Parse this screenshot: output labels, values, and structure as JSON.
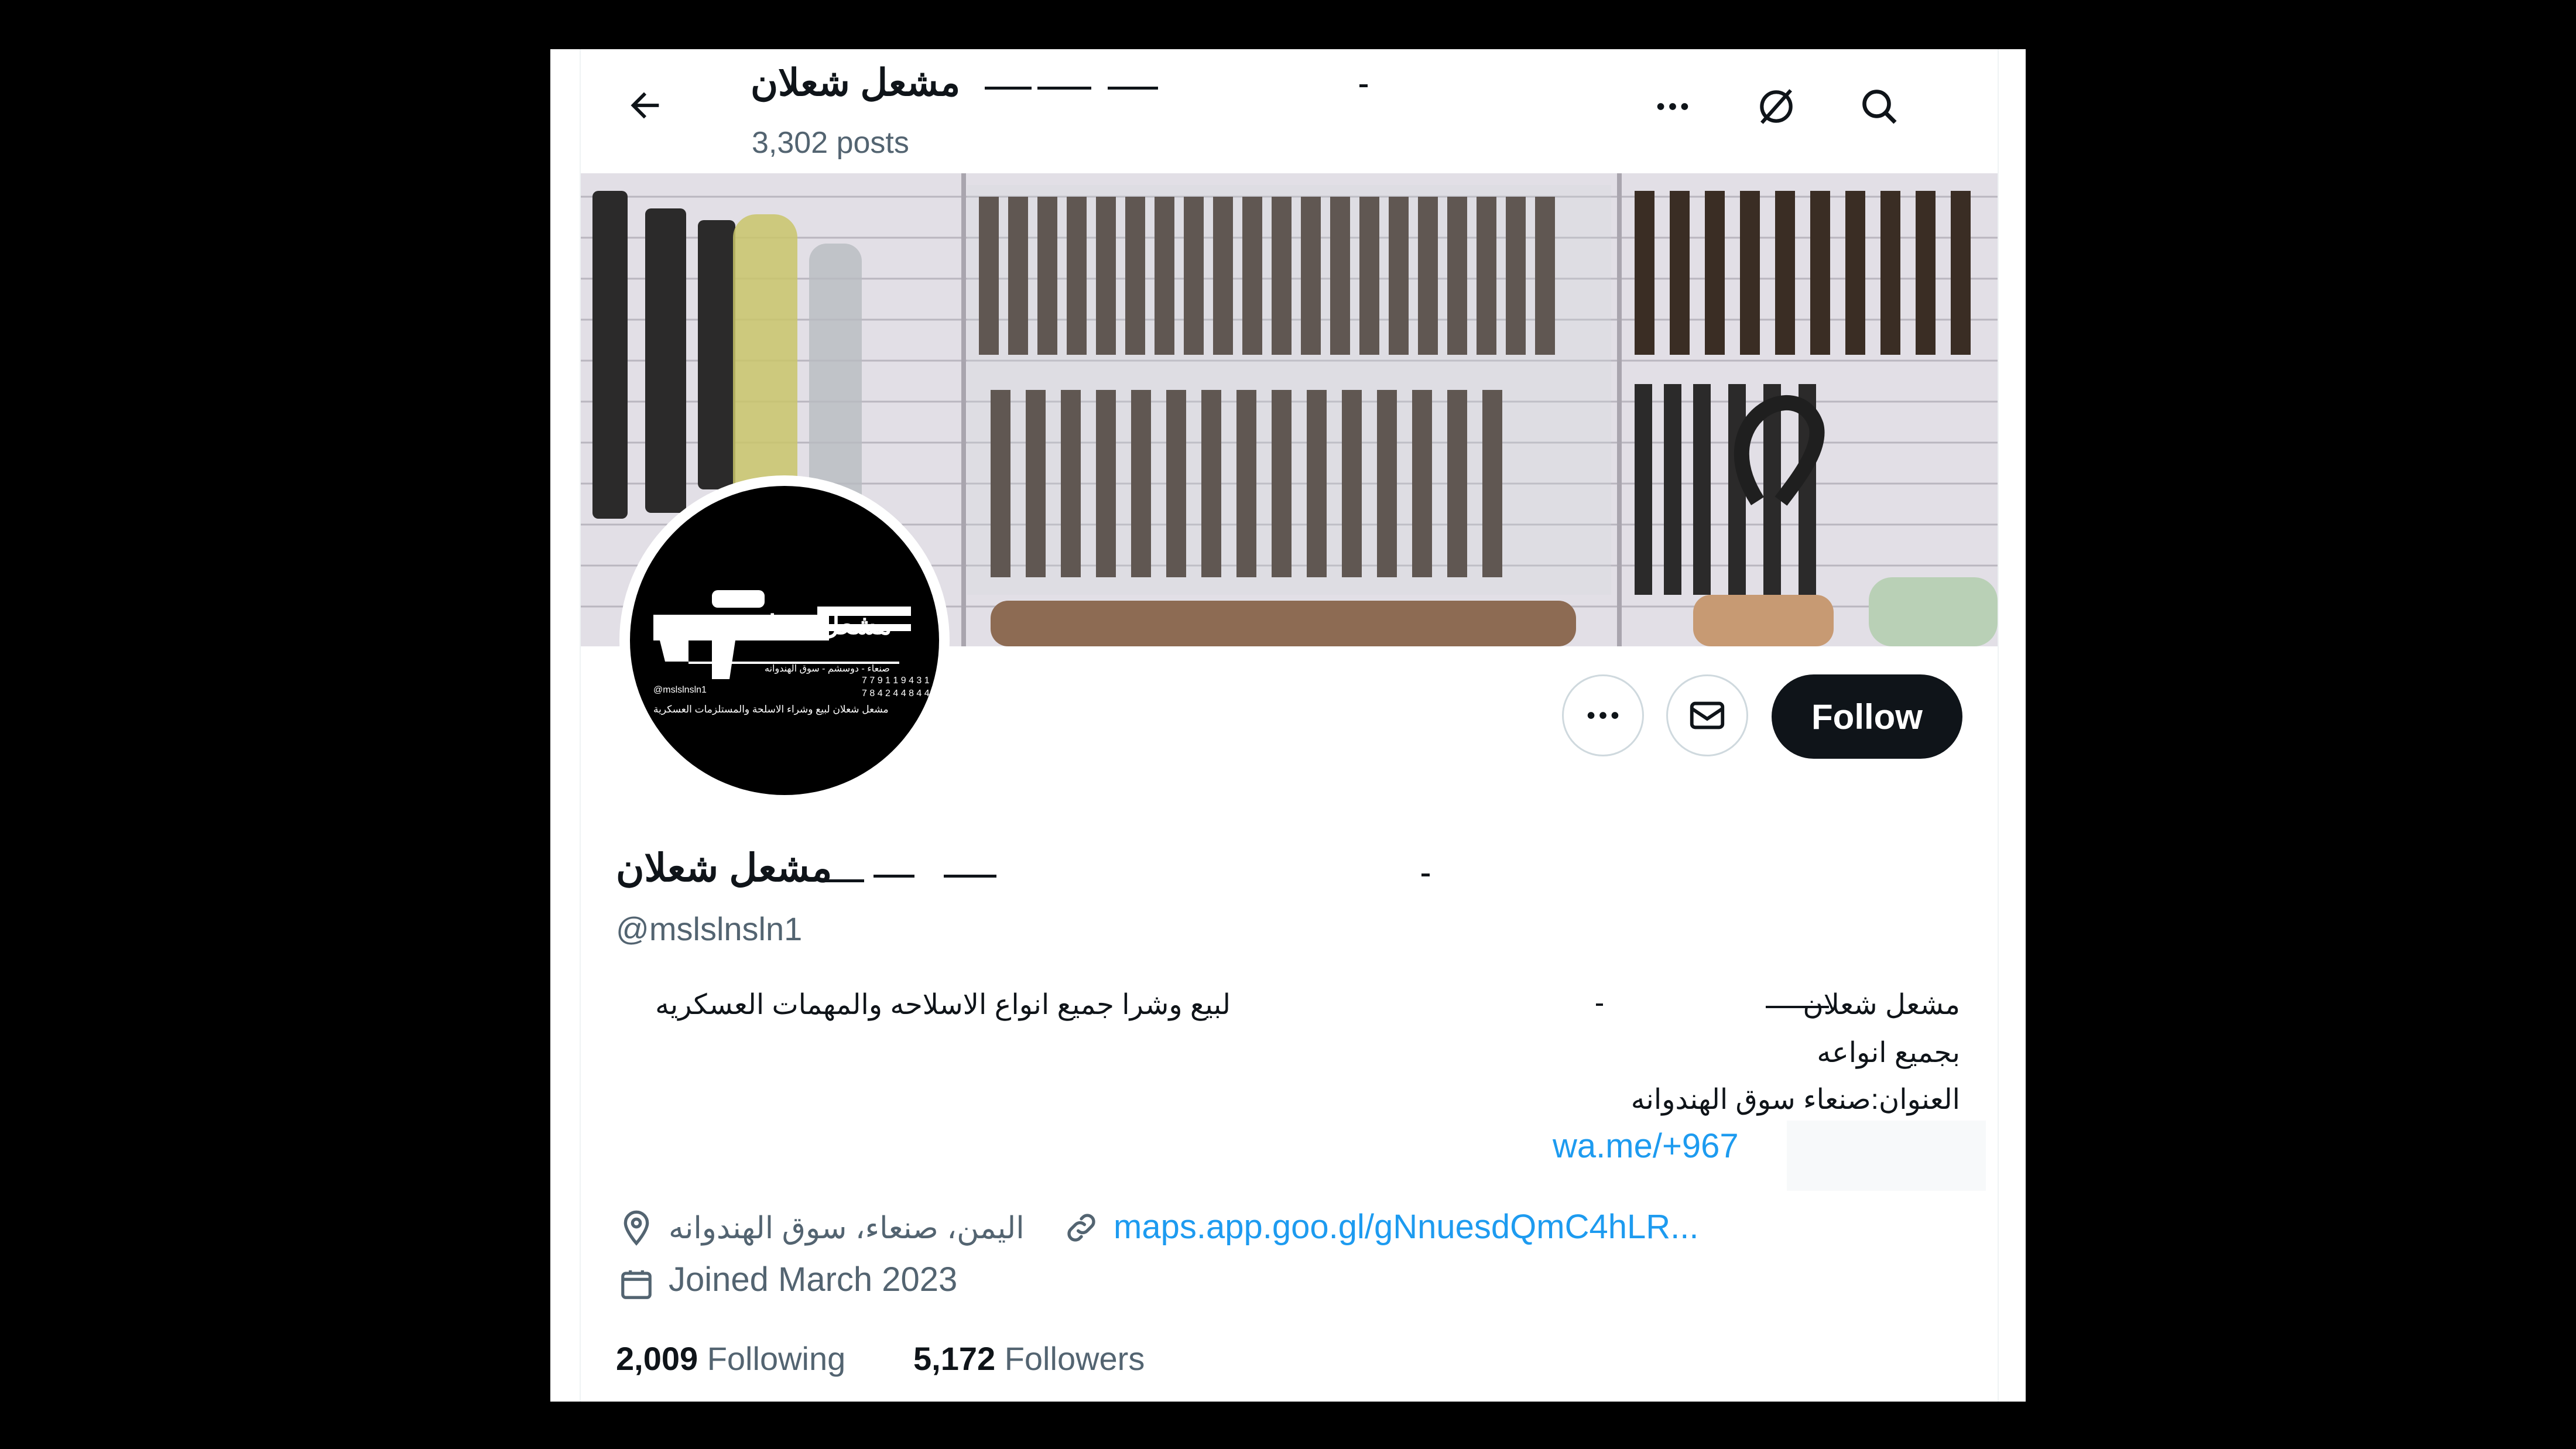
{
  "header": {
    "title": "مشعل شعلان",
    "posts_count": "3,302 posts"
  },
  "banner": {
    "description_icon": "photo-banner"
  },
  "avatar": {
    "logo_text": "مشعل شعلان",
    "logo_numbers_1": "7 7 9 1 1 9 4 3 1",
    "logo_numbers_2": "7 8 4 2 4 4 8 4 4",
    "logo_handle": "@mslslnsln1",
    "logo_address": "صنعاء - دوسشم - سوق الهندوانه",
    "logo_tagline": "مشعل شعلان لبيع وشراء الاسلحة والمستلزمات العسكرية"
  },
  "actions": {
    "follow_label": "Follow"
  },
  "profile": {
    "display_name": "مشعل شعلان",
    "handle": "@mslslnsln1",
    "bio": [
      "مشعل شعلان",
      "لبيع وشرا جميع انواع الاسلاحه والمهمات العسكريه",
      "بجميع انواعه",
      "العنوان:صنعاء سوق الهندوانه"
    ],
    "bio_link": "wa.me/+967",
    "location": "اليمن، صنعاء، سوق الهندوانه",
    "website": "maps.app.goo.gl/gNnuesdQmC4hLR...",
    "joined": "Joined March 2023"
  },
  "stats": {
    "following_count": "2,009",
    "following_label": "Following",
    "followers_count": "5,172",
    "followers_label": "Followers"
  },
  "colors": {
    "accent": "#1d9bf0",
    "text_primary": "#0f1419",
    "text_secondary": "#536471",
    "border": "#cfd9de"
  }
}
